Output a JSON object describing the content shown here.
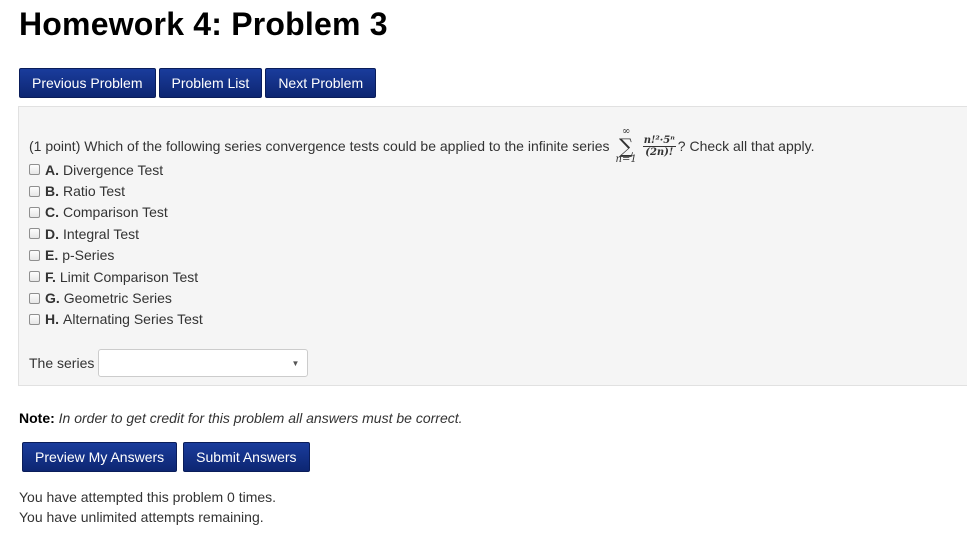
{
  "page": {
    "title": "Homework 4: Problem 3"
  },
  "nav": {
    "previous_label": "Previous Problem",
    "list_label": "Problem List",
    "next_label": "Next Problem"
  },
  "problem": {
    "intro": "(1 point) Which of the following series convergence tests could be applied to the infinite series",
    "sum_upper": "∞",
    "sum_symbol": "∑",
    "sum_lower": "n=1",
    "numerator": "n!²·5ⁿ",
    "denominator": "(2n)!",
    "outro": "? Check all that apply.",
    "options": [
      {
        "letter": "A.",
        "label": "Divergence Test",
        "checked": false
      },
      {
        "letter": "B.",
        "label": "Ratio Test",
        "checked": false
      },
      {
        "letter": "C.",
        "label": "Comparison Test",
        "checked": false
      },
      {
        "letter": "D.",
        "label": "Integral Test",
        "checked": false
      },
      {
        "letter": "E.",
        "label": "p-Series",
        "checked": false
      },
      {
        "letter": "F.",
        "label": "Limit Comparison Test",
        "checked": false
      },
      {
        "letter": "G.",
        "label": "Geometric Series",
        "checked": false
      },
      {
        "letter": "H.",
        "label": "Alternating Series Test",
        "checked": false
      }
    ],
    "series_label": "The series",
    "series_select_value": ""
  },
  "note": {
    "label": "Note:",
    "text": "In order to get credit for this problem all answers must be correct."
  },
  "actions": {
    "preview_label": "Preview My Answers",
    "submit_label": "Submit Answers"
  },
  "status": {
    "attempts": "You have attempted this problem 0 times.",
    "remaining": "You have unlimited attempts remaining."
  },
  "colors": {
    "button_bg": "#0d2672",
    "panel_bg": "#f5f5f5"
  }
}
